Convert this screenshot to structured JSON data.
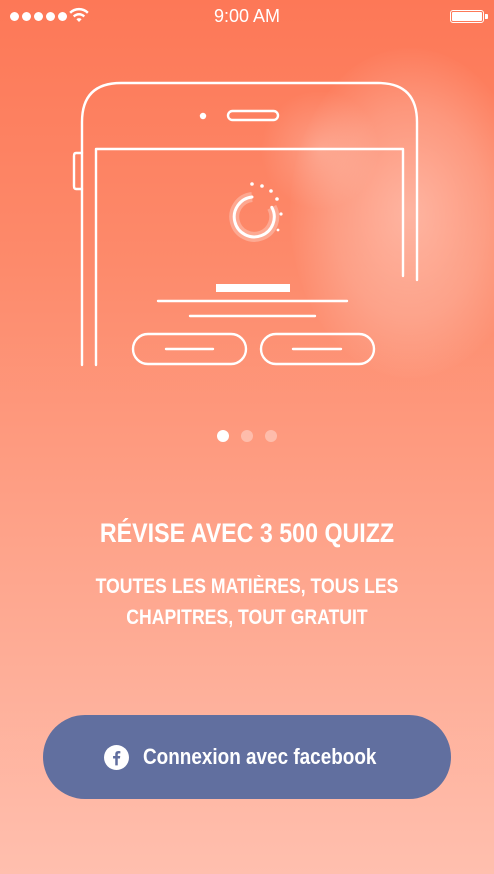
{
  "status_bar": {
    "time": "9:00 AM",
    "signal_icon": "signal-dots-icon",
    "wifi_icon": "wifi-icon",
    "battery_icon": "battery-icon",
    "battery_level": 1.0
  },
  "onboarding": {
    "illustration_icon": "phone-loading-illustration",
    "pager": {
      "total": 3,
      "active_index": 0
    },
    "headline": "RÉVISE AVEC 3 500 QUIZZ",
    "subtitle_line1": "TOUTES LES MATIÈRES, TOUS LES",
    "subtitle_line2": "CHAPITRES, TOUT GRATUIT"
  },
  "facebook_button": {
    "label": "Connexion avec facebook",
    "icon": "facebook-icon",
    "background": "#616f9f"
  },
  "colors": {
    "gradient_top": "#fd7857",
    "gradient_bottom": "#ffbfae",
    "text": "#ffffff"
  }
}
